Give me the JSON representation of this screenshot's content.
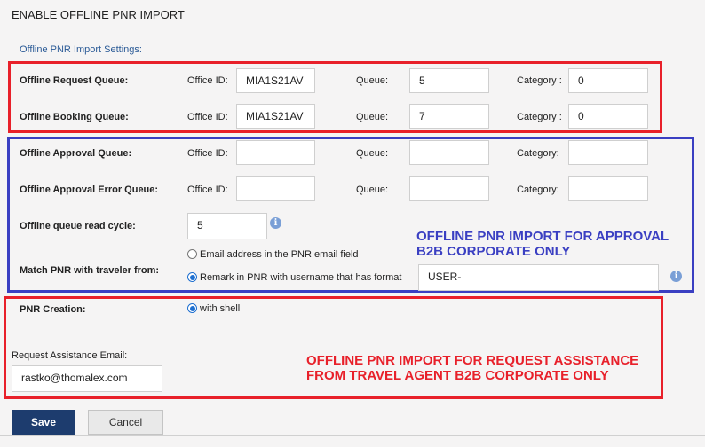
{
  "page": {
    "title": "ENABLE OFFLINE PNR IMPORT",
    "section_title": "Offline PNR Import Settings:"
  },
  "labels": {
    "office_id": "Office ID:",
    "queue": "Queue:",
    "category": "Category :",
    "category_alt": "Category:"
  },
  "rows": {
    "request": {
      "label": "Offline Request Queue:",
      "office_id": "MIA1S21AV",
      "queue": "5",
      "category": "0"
    },
    "booking": {
      "label": "Offline Booking Queue:",
      "office_id": "MIA1S21AV",
      "queue": "7",
      "category": "0"
    },
    "approval": {
      "label": "Offline Approval Queue:",
      "office_id": "",
      "queue": "",
      "category": ""
    },
    "approval_error": {
      "label": "Offline Approval Error Queue:",
      "office_id": "",
      "queue": "",
      "category": ""
    }
  },
  "read_cycle": {
    "label": "Offline queue read cycle:",
    "value": "5"
  },
  "match": {
    "label": "Match PNR with traveler from:",
    "option_email": "Email address in the PNR email field",
    "option_remark": "Remark in PNR with username that has format",
    "remark_format": "USER-",
    "selected": "remark"
  },
  "pnr_creation": {
    "label": "PNR Creation:",
    "option": "with shell"
  },
  "assistance": {
    "label": "Request Assistance Email:",
    "value": "rastko@thomalex.com"
  },
  "annotations": {
    "blue_line1": "OFFLINE PNR IMPORT FOR APPROVAL",
    "blue_line2": "B2B CORPORATE ONLY",
    "red_line1": "OFFLINE PNR IMPORT FOR REQUEST ASSISTANCE",
    "red_line2": "FROM TRAVEL AGENT B2B CORPORATE ONLY"
  },
  "buttons": {
    "save": "Save",
    "cancel": "Cancel"
  },
  "colors": {
    "annotation_red": "#e8202a",
    "annotation_blue": "#3a3fc2",
    "save_bg": "#1d3c6e",
    "info_icon": "#7a9fd6"
  },
  "icons": {
    "info": "info-icon"
  }
}
